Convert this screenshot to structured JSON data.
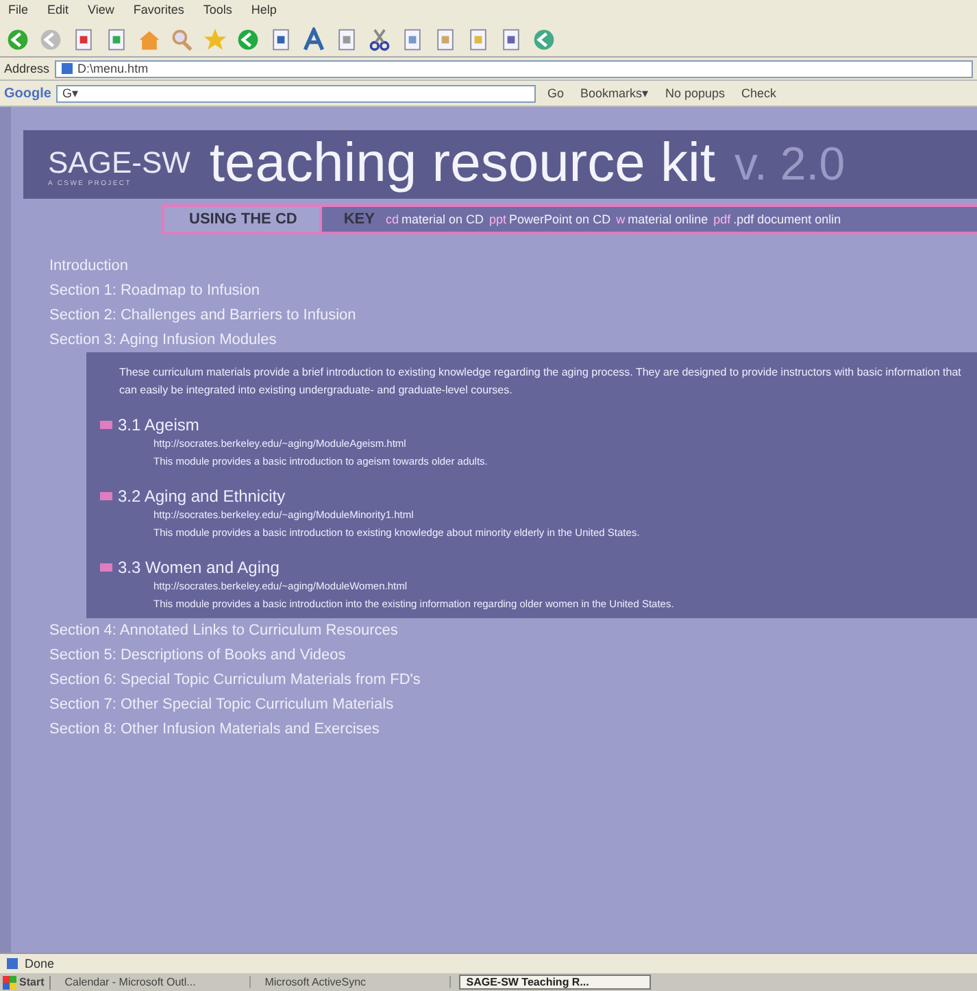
{
  "menu_bar": [
    "File",
    "Edit",
    "View",
    "Favorites",
    "Tools",
    "Help"
  ],
  "address_bar": {
    "label": "Address",
    "value": "D:\\menu.htm"
  },
  "google_bar": {
    "logo": "Google",
    "search_prefix": "G▾",
    "buttons": [
      "Go",
      "Bookmarks▾",
      "No popups",
      "Check"
    ]
  },
  "header": {
    "logo": "SAGE-SW",
    "logo_subtitle": "A CSWE PROJECT",
    "title": "teaching resource kit",
    "version": "v. 2.0"
  },
  "key_bar": {
    "using_label": "USING THE CD",
    "key_label": "KEY",
    "items": [
      {
        "tag": "cd",
        "text": "material on CD"
      },
      {
        "tag": "ppt",
        "text": "PowerPoint on CD"
      },
      {
        "tag": "w",
        "text": "material online"
      },
      {
        "tag": "pdf",
        "text": ".pdf document onlin"
      }
    ]
  },
  "sections": [
    {
      "label": "Introduction",
      "expanded": false
    },
    {
      "label": "Section 1: Roadmap to Infusion",
      "expanded": false
    },
    {
      "label": "Section 2: Challenges and Barriers to Infusion",
      "expanded": false
    },
    {
      "label": "Section 3: Aging Infusion Modules",
      "expanded": true,
      "intro": "These curriculum materials provide a brief introduction to existing knowledge regarding the aging process.  They are designed to provide instructors with basic information that can easily be integrated into existing undergraduate- and graduate-level courses.",
      "modules": [
        {
          "title": "3.1 Ageism",
          "url": "http://socrates.berkeley.edu/~aging/ModuleAgeism.html",
          "description": "This module provides a basic introduction to ageism towards older adults."
        },
        {
          "title": "3.2 Aging and Ethnicity",
          "url": "http://socrates.berkeley.edu/~aging/ModuleMinority1.html",
          "description": "This module provides a basic introduction to existing knowledge about minority elderly in the United States."
        },
        {
          "title": "3.3 Women and Aging",
          "url": "http://socrates.berkeley.edu/~aging/ModuleWomen.html",
          "description": "This module provides a basic introduction into the existing information regarding older women in the United States."
        }
      ]
    },
    {
      "label": "Section 4: Annotated Links to Curriculum Resources",
      "expanded": false
    },
    {
      "label": "Section 5: Descriptions of Books and Videos",
      "expanded": false
    },
    {
      "label": "Section 6: Special Topic Curriculum Materials from FD's",
      "expanded": false
    },
    {
      "label": "Section 7: Other Special Topic Curriculum Materials",
      "expanded": false
    },
    {
      "label": "Section 8: Other Infusion Materials and Exercises",
      "expanded": false
    }
  ],
  "status_bar": {
    "text": "Done"
  },
  "taskbar": {
    "start": "Start",
    "tasks": [
      {
        "label": "Calendar - Microsoft Outl...",
        "selected": false
      },
      {
        "label": "Microsoft ActiveSync",
        "selected": false
      },
      {
        "label": "SAGE-SW Teaching R...",
        "selected": true
      }
    ]
  }
}
